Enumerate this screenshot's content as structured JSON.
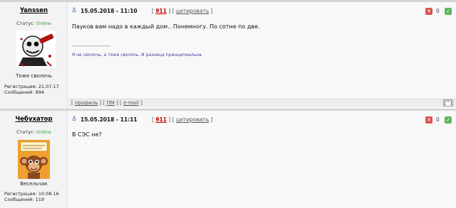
{
  "posts": [
    {
      "author": "Yanssen",
      "status_label": "Статус:",
      "status_value": "Online",
      "user_title": "Тоже сволочь",
      "reg_line": "Регистрация: 21.07.17",
      "msg_line": "Сообщений: 894",
      "datetime": "15.05.2018 - 11:10",
      "post_number": "911",
      "quote_label": "цитировать",
      "message": "Пауков вам надо в каждый дом.. Понемногу. По сотне по две.",
      "sig_line": "--------------------",
      "signature": "Я не сволочь, а тоже сволочь. И разница принципиальна.",
      "vote_count": "0",
      "footer_links": [
        "профиль",
        "ПМ",
        "e-mail"
      ],
      "to_top": "[^]"
    },
    {
      "author": "Чебухатор",
      "status_label": "Статус:",
      "status_value": "Online",
      "user_title": "Весельчак",
      "reg_line": "Регистрация: 10.08.16",
      "msg_line": "Сообщений: 119",
      "datetime": "15.05.2018 - 11:11",
      "post_number": "911",
      "quote_label": "цитировать",
      "message": "В СЭС не?",
      "vote_count": "0"
    }
  ],
  "icons": {
    "anchor": "anchor-icon",
    "vote_down": "thumbs-down-icon",
    "vote_up": "thumbs-up-icon"
  },
  "colors": {
    "online": "#2a9a2a",
    "post_number": "#c00000",
    "signature": "#4a3aa0"
  }
}
